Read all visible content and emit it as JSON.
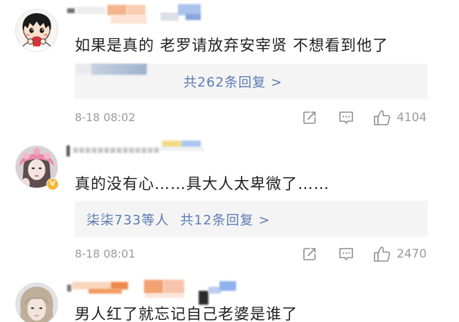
{
  "colors": {
    "text": "#222222",
    "link": "#5b7bb3",
    "meta": "#9b9b9b",
    "icon": "#8c8c8c",
    "reply_bg": "#f4f4f4",
    "verified_badge": "#f5b83b"
  },
  "icons": {
    "share": "share-icon",
    "comment": "comment-icon",
    "like": "like-icon"
  },
  "comments": [
    {
      "text": "如果是真的 老罗请放弃安宰贤 不想看到他了",
      "reply_preview": {
        "count_label": "共262条回复 >"
      },
      "time": "8-18 08:02",
      "likes": "4104"
    },
    {
      "verified_badge": "V",
      "text": "真的没有心……具大人太卑微了……",
      "reply_preview": {
        "users": "柒柒733等人",
        "count_label": "共12条回复 >"
      },
      "time": "8-18 08:01",
      "likes": "2470"
    },
    {
      "text": "男人红了就忘记自己老婆是谁了"
    }
  ]
}
